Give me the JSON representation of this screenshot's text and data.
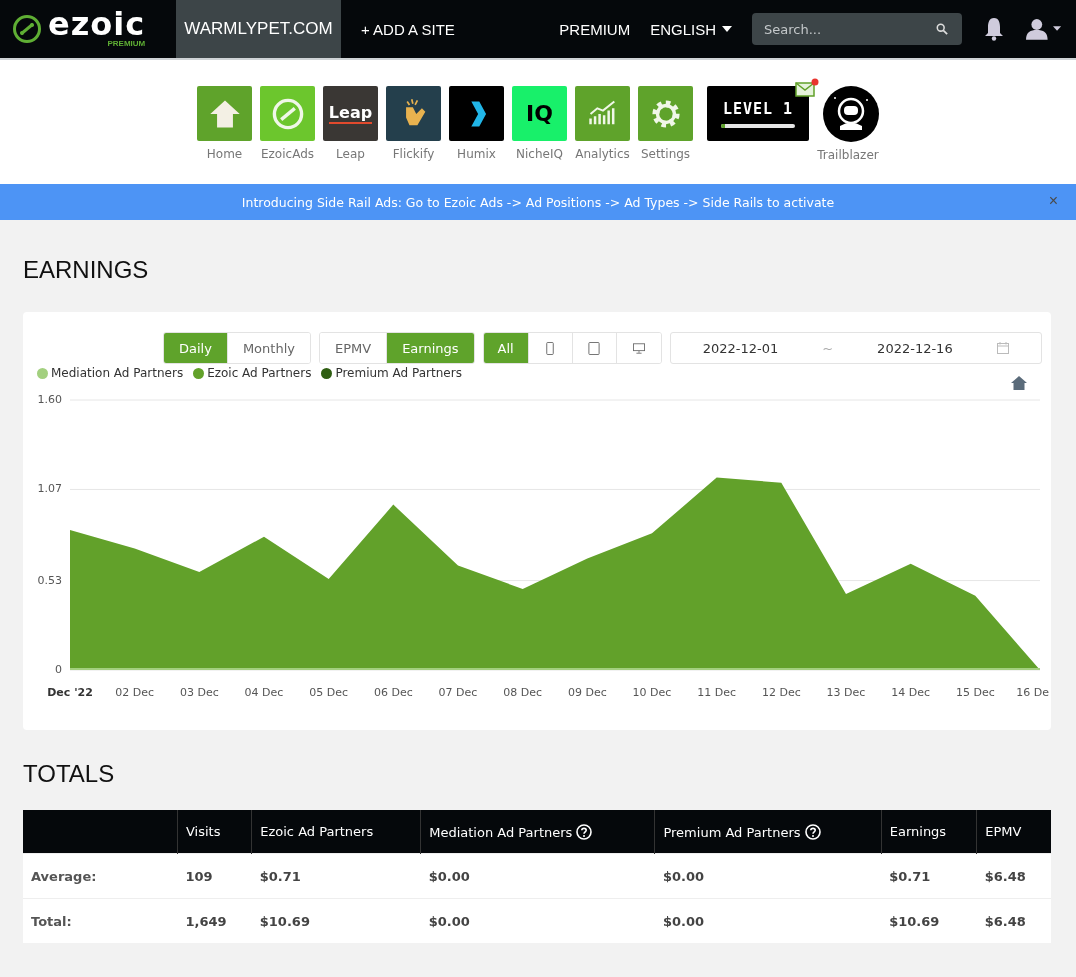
{
  "navbar": {
    "logo_text": "ezoic",
    "logo_subtext": "PREMIUM",
    "site": "WARMLYPET.COM",
    "add_site": "+ ADD A SITE",
    "premium": "PREMIUM",
    "language": "ENGLISH",
    "search": {
      "placeholder": "Search..."
    }
  },
  "apps": [
    {
      "label": "Home",
      "kind": "home"
    },
    {
      "label": "EzoicAds",
      "kind": "ezoic"
    },
    {
      "label": "Leap",
      "kind": "leap",
      "tile_text": "Leap"
    },
    {
      "label": "Flickify",
      "kind": "flickify"
    },
    {
      "label": "Humix",
      "kind": "humix"
    },
    {
      "label": "NicheIQ",
      "kind": "nicheiq",
      "tile_text": "IQ"
    },
    {
      "label": "Analytics",
      "kind": "analytics"
    },
    {
      "label": "Settings",
      "kind": "settings"
    }
  ],
  "level_badge": {
    "text": "LEVEL 1",
    "level": 0.06,
    "has_mail": true
  },
  "trailblazer": {
    "label": "Trailblazer"
  },
  "banner": {
    "text": "Introducing Side Rail Ads: Go to Ezoic Ads -> Ad Positions -> Ad Types -> Side Rails to activate",
    "close": "×"
  },
  "earnings": {
    "title": "EARNINGS",
    "period_tabs": [
      {
        "label": "Daily",
        "selected": true
      },
      {
        "label": "Monthly",
        "selected": false
      }
    ],
    "metric_tabs": [
      {
        "label": "EPMV",
        "selected": false
      },
      {
        "label": "Earnings",
        "selected": true
      }
    ],
    "device_tabs": [
      {
        "kind": "text",
        "label": "All",
        "selected": true
      },
      {
        "kind": "phone",
        "selected": false
      },
      {
        "kind": "tablet",
        "selected": false
      },
      {
        "kind": "desktop",
        "selected": false
      }
    ],
    "date_range": {
      "start": "2022-12-01",
      "separator": "~",
      "end": "2022-12-16"
    },
    "legend": [
      {
        "kind": "other",
        "name": "Mediation Ad Partners",
        "color": "#a3d07f"
      },
      {
        "kind": "series"
      },
      {
        "kind": "other",
        "name": "Premium Ad Partners",
        "color": "#2f5e12"
      }
    ],
    "chart_data": {
      "type": "area",
      "categories": [
        "Dec '22",
        "02 Dec",
        "03 Dec",
        "04 Dec",
        "05 Dec",
        "06 Dec",
        "07 Dec",
        "08 Dec",
        "09 Dec",
        "10 Dec",
        "11 Dec",
        "12 Dec",
        "13 Dec",
        "14 Dec",
        "15 Dec",
        "16 De"
      ],
      "series": [
        {
          "name": "Ezoic Ad Partners",
          "color": "#62a12a",
          "values": [
            0.83,
            0.72,
            0.58,
            0.79,
            0.54,
            0.98,
            0.62,
            0.48,
            0.66,
            0.81,
            1.14,
            1.11,
            0.45,
            0.63,
            0.44,
            0
          ]
        }
      ],
      "ylim": [
        0,
        1.6
      ],
      "yticks": [
        0,
        0.53,
        1.07,
        {
          "value": 1.6,
          "label": "1.60"
        }
      ]
    }
  },
  "totals": {
    "title": "TOTALS",
    "columns": [
      {
        "label": "Visits",
        "help": false
      },
      {
        "label": "Ezoic Ad Partners",
        "help": false
      },
      {
        "label": "Mediation Ad Partners",
        "help": true
      },
      {
        "label": "Premium Ad Partners",
        "help": true
      },
      {
        "label": "Earnings",
        "help": false
      },
      {
        "label": "EPMV",
        "help": false
      }
    ],
    "rows": [
      {
        "label": "Average:",
        "cells": [
          "109",
          "$0.71",
          "$0.00",
          "$0.00",
          "$0.71",
          "$6.48"
        ]
      },
      {
        "label": "Total:",
        "cells": [
          "1,649",
          "$10.69",
          "$0.00",
          "$0.00",
          "$10.69",
          "$6.48"
        ]
      }
    ]
  }
}
